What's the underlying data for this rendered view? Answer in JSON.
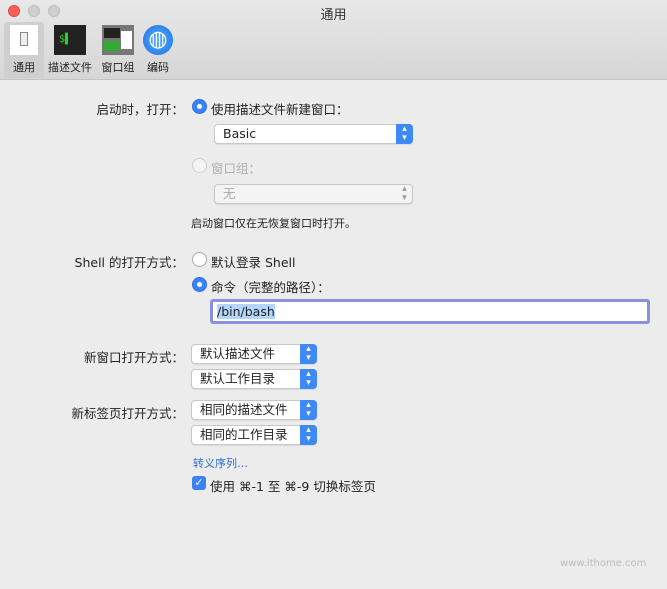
{
  "window": {
    "title": "通用"
  },
  "toolbar": [
    {
      "label": "通用",
      "icon": "general-icon"
    },
    {
      "label": "描述文件",
      "icon": "profile-icon"
    },
    {
      "label": "窗口组",
      "icon": "window-group-icon"
    },
    {
      "label": "编码",
      "icon": "globe-icon"
    }
  ],
  "startup": {
    "label": "启动时，打开：",
    "option1": "使用描述文件新建窗口：",
    "profile_value": "Basic",
    "option2": "窗口组：",
    "group_value": "无",
    "note": "启动窗口仅在无恢复窗口时打开。"
  },
  "shell": {
    "label": "Shell 的打开方式：",
    "option1": "默认登录 Shell",
    "option2": "命令（完整的路径）：",
    "command_value": "/bin/bash"
  },
  "new_window": {
    "label": "新窗口打开方式：",
    "profile": "默认描述文件",
    "directory": "默认工作目录"
  },
  "new_tab": {
    "label": "新标签页打开方式：",
    "profile": "相同的描述文件",
    "directory": "相同的工作目录"
  },
  "escape_link": "转义序列…",
  "tab_switch_checkbox": {
    "label": "使用 ⌘-1 至 ⌘-9 切换标签页",
    "checked": true
  },
  "watermark": "www.ithome.com",
  "colors": {
    "accent": "#3b82f6"
  }
}
